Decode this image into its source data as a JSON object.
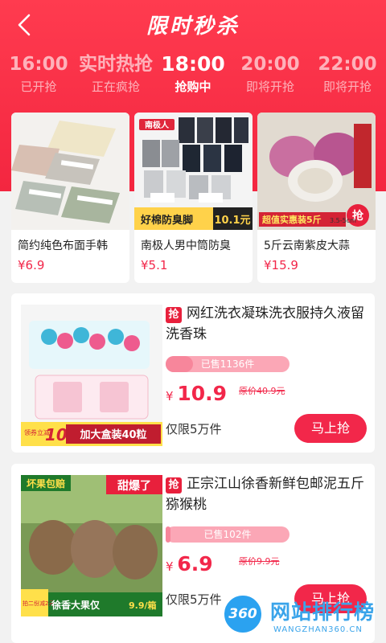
{
  "header": {
    "title": "限时秒杀",
    "back_icon": "back-arrow-icon"
  },
  "time_slots": [
    {
      "time": "16:00",
      "status": "已开抢"
    },
    {
      "time": "实时热抢",
      "status": "正在疯抢"
    },
    {
      "time": "18:00",
      "status": "抢购中"
    },
    {
      "time": "20:00",
      "status": "即将开抢"
    },
    {
      "time": "22:00",
      "status": "即将开抢"
    }
  ],
  "top_products": [
    {
      "name": "简约纯色布面手韩",
      "price": "¥6.9",
      "badge": "",
      "banner": "",
      "banner_price": ""
    },
    {
      "name": "南极人男中筒防臭",
      "price": "¥5.1",
      "badge": "南极人",
      "banner": "好棉防臭脚",
      "banner_price": "10.1元"
    },
    {
      "name": "5斤云南紫皮大蒜",
      "price": "¥15.9",
      "badge": "抢",
      "banner": "超值实惠装5斤",
      "banner_price": "3.5-5cm"
    }
  ],
  "list_products": [
    {
      "tag": "抢",
      "name": "网红洗衣凝珠洗衣服持久液留洗香珠",
      "sold": "已售1136件",
      "sold_ratio": 0.22,
      "currency": "¥",
      "price": "10.9",
      "orig_price": "原价40.9元",
      "limit": "仅限5万件",
      "buy": "马上抢",
      "banner_num": "10",
      "banner_text": "加大盒装40粒",
      "banner_tag": "领券立减"
    },
    {
      "tag": "抢",
      "name": "正宗江山徐香新鲜包邮泥五斤猕猴桃",
      "sold": "已售102件",
      "sold_ratio": 0.04,
      "currency": "¥",
      "price": "6.9",
      "orig_price": "原价9.9元",
      "limit": "仅限5万件",
      "buy": "马上抢",
      "banner_top_left": "坏果包赔",
      "banner_top_right": "甜爆了",
      "banner_tag": "拍二份减2元",
      "banner_text": "徐香大果仅",
      "banner_price": "9.9/箱"
    }
  ],
  "watermark": {
    "logo": "360",
    "text": "网站排行榜",
    "url": "WANGZHAN360.CN"
  },
  "colors": {
    "primary": "#f2274a",
    "header": "#ff3b4f",
    "watermark": "#3aa4ea"
  }
}
